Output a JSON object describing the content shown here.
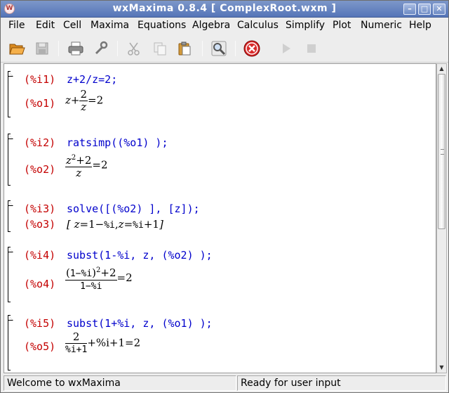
{
  "window": {
    "title": "wxMaxima 0.8.4  [ ComplexRoot.wxm ]"
  },
  "menus": [
    "File",
    "Edit",
    "Cell",
    "Maxima",
    "Equations",
    "Algebra",
    "Calculus",
    "Simplify",
    "Plot",
    "Numeric",
    "Help"
  ],
  "toolbar": {
    "icons": [
      "open-icon",
      "save-icon",
      "print-icon",
      "preferences-icon",
      "cut-icon",
      "copy-icon",
      "paste-icon",
      "find-icon",
      "interrupt-icon",
      "continue-icon",
      "stop-icon"
    ]
  },
  "cells": [
    {
      "in_label": "(%i1)",
      "input": "z+2/z=2;",
      "out_label": "(%o1)",
      "out": {
        "a": "z",
        "plus": "+",
        "num": "2",
        "den": "z",
        "rhs": "=2"
      }
    },
    {
      "in_label": "(%i2)",
      "input": "ratsimp((%o1) );",
      "out_label": "(%o2)",
      "out": {
        "num_base": "z",
        "num_exp": "2",
        "num_rest": "+2",
        "den": "z",
        "rhs": "=2"
      }
    },
    {
      "in_label": "(%i3)",
      "input": "solve([(%o2) ], [z]);",
      "out_label": "(%o3)",
      "out": {
        "open": "[",
        "z1": "z",
        "e1": "=1−",
        "i1": "%i",
        "comma": ",",
        "z2": "z",
        "e2": "=",
        "i2": "%i",
        "e3": "+1",
        "close": "]"
      }
    },
    {
      "in_label": "(%i4)",
      "input": "subst(1-%i, z, (%o2) );",
      "out_label": "(%o4)",
      "out": {
        "num_inner": "1−%i",
        "num_exp": "2",
        "num_rest": "+2",
        "den": "1−%i",
        "rhs": "=2"
      }
    },
    {
      "in_label": "(%i5)",
      "input": "subst(1+%i, z, (%o1) );",
      "out_label": "(%o5)",
      "out": {
        "num": "2",
        "den": "%i+1",
        "rest": "+%i+1=2"
      }
    }
  ],
  "status": {
    "left": "Welcome to wxMaxima",
    "right": "Ready for user input"
  },
  "colors": {
    "label": "#c40000",
    "input": "#0000cc",
    "titlebar": "#5575b8"
  }
}
